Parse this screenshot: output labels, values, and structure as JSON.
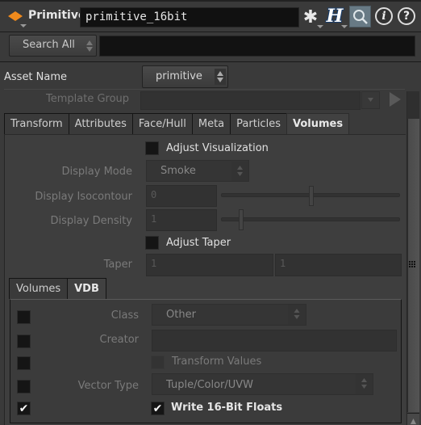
{
  "header": {
    "node_type": "Primitive",
    "node_name": "primitive_16bit",
    "icons": [
      "node-type-diamond-icon",
      "gear-icon",
      "houdini-h-icon",
      "search-icon",
      "info-icon",
      "help-icon"
    ]
  },
  "search": {
    "button_label": "Search All",
    "input_value": ""
  },
  "asset": {
    "label": "Asset Name",
    "value": "primitive"
  },
  "template_group": {
    "label": "Template Group",
    "value": ""
  },
  "tabs": [
    {
      "label": "Transform",
      "active": false
    },
    {
      "label": "Attributes",
      "active": false
    },
    {
      "label": "Face/Hull",
      "active": false
    },
    {
      "label": "Meta",
      "active": false
    },
    {
      "label": "Particles",
      "active": false
    },
    {
      "label": "Volumes",
      "active": true
    }
  ],
  "volumes": {
    "adjust_visualization": {
      "label": "Adjust Visualization",
      "checked": false
    },
    "display_mode": {
      "label": "Display Mode",
      "value": "Smoke"
    },
    "display_isocontour": {
      "label": "Display Isocontour",
      "value": "0",
      "slider_fraction": 0.49
    },
    "display_density": {
      "label": "Display Density",
      "value": "1",
      "slider_fraction": 0.1
    },
    "adjust_taper": {
      "label": "Adjust Taper",
      "checked": false
    },
    "taper": {
      "label": "Taper",
      "values": [
        "1",
        "1"
      ]
    }
  },
  "subtabs": [
    {
      "label": "Volumes",
      "active": false
    },
    {
      "label": "VDB",
      "active": true
    }
  ],
  "vdb": {
    "class": {
      "label": "Class",
      "value": "Other",
      "enabled": false
    },
    "creator": {
      "label": "Creator",
      "value": "",
      "enabled": false
    },
    "transform_values": {
      "label": "Transform Values",
      "enabled": false,
      "checked": false
    },
    "vector_type": {
      "label": "Vector Type",
      "value": "Tuple/Color/UVW",
      "enabled": false
    },
    "write_16bit": {
      "label": "Write 16-Bit Floats",
      "enabled": true,
      "checked": true
    }
  },
  "colors": {
    "background": "#3a3a3a",
    "node_icon": "#f08a1c",
    "search_icon_bg": "#687a85"
  }
}
